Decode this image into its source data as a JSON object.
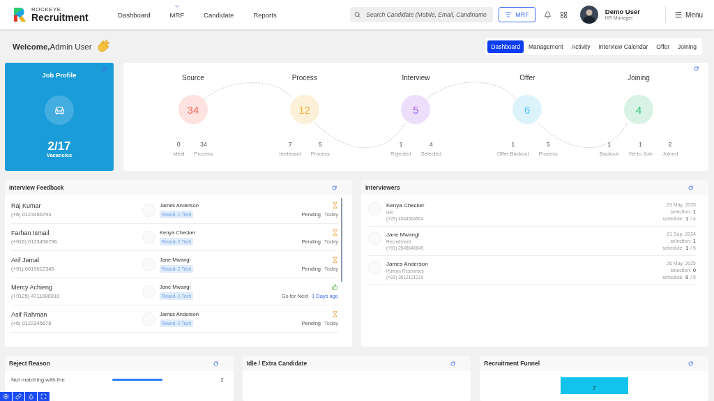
{
  "brand": {
    "top": "ROCKEYE",
    "name": "Recruitment"
  },
  "nav": [
    {
      "label": "Dashboard",
      "dropdown": false
    },
    {
      "label": "MRF",
      "dropdown": true
    },
    {
      "label": "Candidate",
      "dropdown": false
    },
    {
      "label": "Reports",
      "dropdown": false
    }
  ],
  "search": {
    "placeholder": "Search Candidate (Mobile, Email, Candiname"
  },
  "mrf_button": "MRF",
  "user": {
    "name": "Demo User",
    "role": "HR Manager"
  },
  "menu_button": "Menu",
  "welcome": "**Welcome,**Admin User",
  "tabs": [
    {
      "label": "Dashboard",
      "selected": true
    },
    {
      "label": "Management",
      "selected": false
    },
    {
      "label": "Activity",
      "selected": false
    },
    {
      "label": "Interview Calendar",
      "selected": false
    },
    {
      "label": "Offer",
      "selected": false
    },
    {
      "label": "Joining",
      "selected": false
    }
  ],
  "job_profile": {
    "title": "Job Profile",
    "count": "2/17",
    "label": "Vacancies"
  },
  "pipeline": [
    {
      "title": "Source",
      "value": "34",
      "color": "#f76d5e",
      "stats": [
        {
          "value": "0",
          "label": "Ideal"
        },
        {
          "value": "34",
          "label": "Process"
        }
      ]
    },
    {
      "title": "Process",
      "value": "12",
      "color": "#f0b43c",
      "stats": [
        {
          "value": "7",
          "label": "Irrelevant"
        },
        {
          "value": "5",
          "label": "Process"
        }
      ]
    },
    {
      "title": "Interview",
      "value": "5",
      "color": "#a55ef2",
      "stats": [
        {
          "value": "1",
          "label": "Rejected"
        },
        {
          "value": "4",
          "label": "Selected"
        }
      ]
    },
    {
      "title": "Offer",
      "value": "6",
      "color": "#4fc3f0",
      "stats": [
        {
          "value": "1",
          "label": "Offer Backout"
        },
        {
          "value": "5",
          "label": "Process"
        }
      ]
    },
    {
      "title": "Joining",
      "value": "4",
      "color": "#3ec47e",
      "stats": [
        {
          "value": "1",
          "label": "Backout"
        },
        {
          "value": "1",
          "label": "Yet to Join"
        },
        {
          "value": "2",
          "label": "Joined"
        }
      ]
    }
  ],
  "interview_feedback": {
    "title": "Interview Feedback",
    "rows": [
      {
        "name": "Raj Kumar",
        "phone": "(+6) 0123456794",
        "interviewer": "James Anderson",
        "round": "Round- 1 Tech",
        "kind": "pending",
        "status": "Pending",
        "when": "Today"
      },
      {
        "name": "Farhan Ismail",
        "phone": "(+916) 0123456796",
        "interviewer": "Kenya Checker",
        "round": "Round- 2 Tech",
        "kind": "pending",
        "status": "Pending",
        "when": "Today"
      },
      {
        "name": "Arif Jamal",
        "phone": "(+91) 6019012345",
        "interviewer": "Jane Mwangi",
        "round": "Round- 2 Tech",
        "kind": "pending",
        "status": "Pending",
        "when": "Today"
      },
      {
        "name": "Mercy Achieng",
        "phone": "(+9125) 4711000010",
        "interviewer": "Jane Mwangi",
        "round": "Round- 1 Tech",
        "kind": "approved",
        "status": "Go for Next",
        "when": "1 Days ago"
      },
      {
        "name": "Asif Rahman",
        "phone": "(+6) 0122345678",
        "interviewer": "James Anderson",
        "round": "Round- 1 Tech",
        "kind": "pending",
        "status": "Pending",
        "when": "Today"
      }
    ]
  },
  "interviewers": {
    "title": "Interviewers",
    "rows": [
      {
        "name": "Kenya Checker",
        "dept": "HR",
        "phone": "(+25) 4544564564",
        "date": "23 May, 2025",
        "selection_label": "selection:",
        "selection": "1",
        "schedule_label": "schedule:",
        "scheduled": "1",
        "schedule_rest": "/ 4"
      },
      {
        "name": "Jane Mwangi",
        "dept": "Recruitment",
        "phone": "(+91) 2545645645",
        "date": "21 Sep, 2024",
        "selection_label": "selection:",
        "selection": "1",
        "schedule_label": "schedule:",
        "scheduled": "1",
        "schedule_rest": "/ 5"
      },
      {
        "name": "James Anderson",
        "dept": "Human Resources",
        "phone": "(+91) 3612121219",
        "date": "26 May, 2025",
        "selection_label": "selection:",
        "selection": "0",
        "schedule_label": "schedule:",
        "scheduled": "0",
        "schedule_rest": "/ 5"
      }
    ]
  },
  "reject_reason": {
    "title": "Reject Reason",
    "rows": [
      {
        "label": "Not matching with the",
        "level": 1,
        "count": "2"
      }
    ]
  },
  "idle_candidate": {
    "title": "Idle / Extra Candidate"
  },
  "recruitment_funnel": {
    "title": "Recruitment Funnel",
    "bar_value": "7"
  }
}
